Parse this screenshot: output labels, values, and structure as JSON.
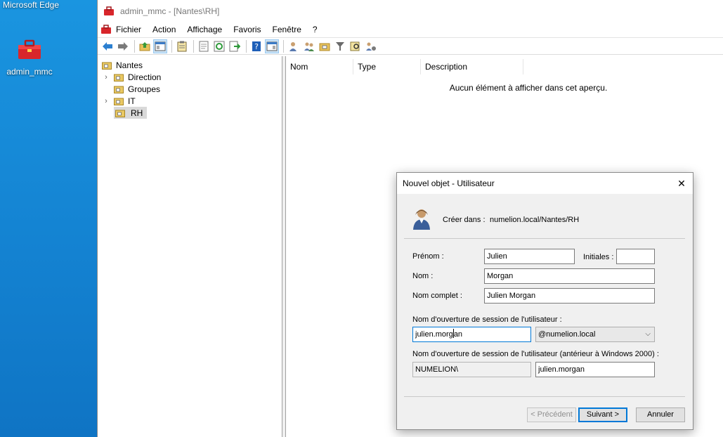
{
  "desktop": {
    "edge_label": "Microsoft Edge",
    "icon_label": "admin_mmc"
  },
  "window": {
    "title": "admin_mmc - [Nantes\\RH]",
    "menu": [
      "Fichier",
      "Action",
      "Affichage",
      "Favoris",
      "Fenêtre",
      "?"
    ]
  },
  "tree": {
    "root": "Nantes",
    "items": [
      {
        "label": "Direction",
        "expandable": true
      },
      {
        "label": "Groupes",
        "expandable": false
      },
      {
        "label": "IT",
        "expandable": true
      },
      {
        "label": "RH",
        "expandable": false,
        "selected": true
      }
    ]
  },
  "results": {
    "columns": [
      "Nom",
      "Type",
      "Description"
    ],
    "empty_message": "Aucun élément à afficher dans cet aperçu."
  },
  "dialog": {
    "title": "Nouvel objet - Utilisateur",
    "close_glyph": "✕",
    "create_in_label": "Créer dans :",
    "create_in_value": "numelion.local/Nantes/RH",
    "firstname_label": "Prénom :",
    "firstname_value": "Julien",
    "initials_label": "Initiales :",
    "initials_value": "",
    "lastname_label": "Nom :",
    "lastname_value": "Morgan",
    "fullname_label": "Nom complet :",
    "fullname_value": "Julien Morgan",
    "logon_label": "Nom d'ouverture de session de l'utilisateur :",
    "logon_value_before_caret": "julien.morg",
    "logon_value_after_caret": "an",
    "domain_suffix": "@numelion.local",
    "logon_pre2000_label": "Nom d'ouverture de session de l'utilisateur (antérieur à Windows 2000) :",
    "domain_prefix": "NUMELION\\",
    "logon_pre2000_value": "julien.morgan",
    "prev_button": "< Précédent",
    "next_button": "Suivant >",
    "cancel_button": "Annuler"
  },
  "colors": {
    "desktop_blue": "#1483d2",
    "focus_blue": "#0078d7",
    "selection_gray": "#d9d9d9"
  }
}
